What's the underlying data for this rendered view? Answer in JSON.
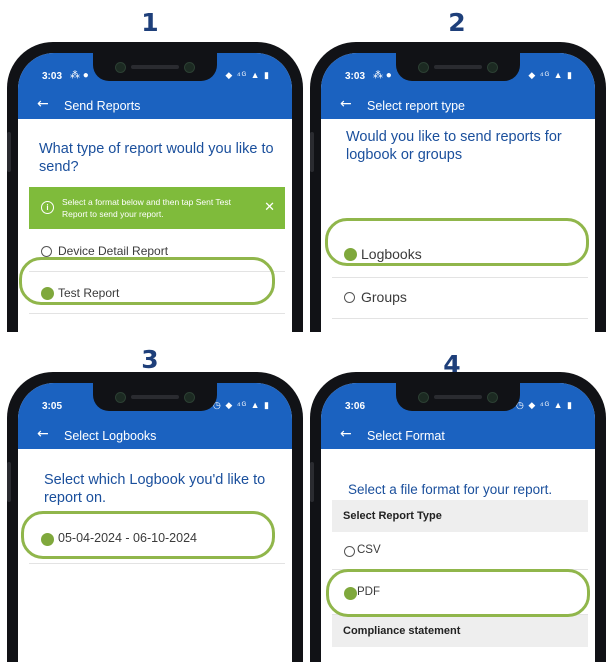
{
  "panels": [
    {
      "number": "1",
      "status": {
        "time": "3:03",
        "time_icons": "⁂ ●",
        "right_icons": "◆ ⁴ᴳ ▲ ▮"
      },
      "toolbar": {
        "back": "←",
        "title": "Send Reports"
      },
      "question": "What type of report would you like to send?",
      "banner": {
        "message": "Select a format below and then tap Sent Test Report to send your report.",
        "info_glyph": "i",
        "close_glyph": "✕"
      },
      "options": [
        {
          "label": "Device Detail Report",
          "selected": false
        },
        {
          "label": "Test Report",
          "selected": true
        }
      ]
    },
    {
      "number": "2",
      "status": {
        "time": "3:03",
        "time_icons": "⁂ ●",
        "right_icons": "◆ ⁴ᴳ ▲ ▮"
      },
      "toolbar": {
        "back": "←",
        "title": "Select report type"
      },
      "question": "Would you like to send reports for logbook or groups",
      "options": [
        {
          "label": "Logbooks",
          "selected": true
        },
        {
          "label": "Groups",
          "selected": false
        }
      ]
    },
    {
      "number": "3",
      "status": {
        "time": "3:05",
        "time_icons": "",
        "right_icons": "◷ ◆ ⁴ᴳ ▲ ▮"
      },
      "toolbar": {
        "back": "←",
        "title": "Select Logbooks"
      },
      "question": "Select which Logbook you'd like to report on.",
      "options": [
        {
          "label": "05-04-2024 - 06-10-2024",
          "selected": true
        }
      ]
    },
    {
      "number": "4",
      "status": {
        "time": "3:06",
        "time_icons": "",
        "right_icons": "◷ ◆ ⁴ᴳ ▲ ▮"
      },
      "toolbar": {
        "back": "←",
        "title": "Select Format"
      },
      "question": "Select a file format for your report.",
      "section_1": "Select Report Type",
      "options": [
        {
          "label": "CSV",
          "selected": false
        },
        {
          "label": "PDF",
          "selected": true
        }
      ],
      "section_2": "Compliance statement"
    }
  ],
  "colors": {
    "app_bar": "#1b62c0",
    "question_text": "#1a4f9c",
    "banner": "#7fbb3b",
    "highlight_ring": "#90b64b",
    "selected_radio": "#7fa83c",
    "step_number": "#1e3f7a"
  },
  "icons": {
    "back": "back-arrow-icon",
    "info": "info-icon",
    "close": "close-icon"
  }
}
